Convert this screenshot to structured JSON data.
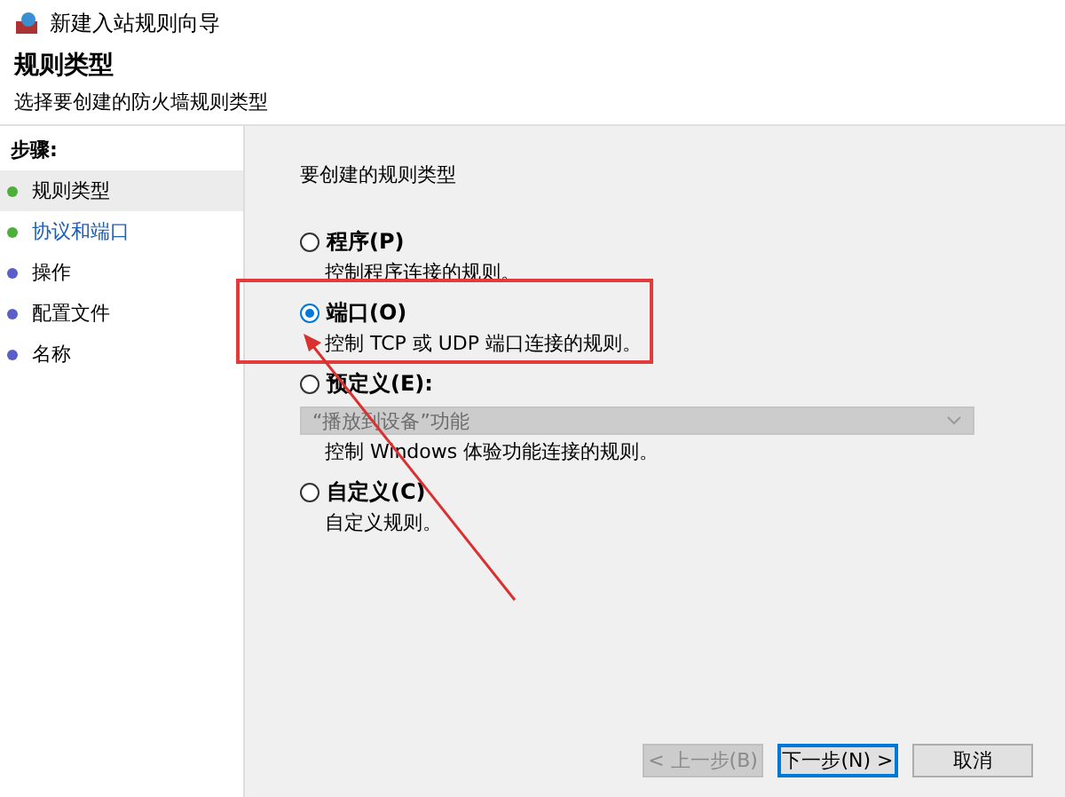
{
  "window": {
    "title": "新建入站规则向导"
  },
  "header": {
    "title": "规则类型",
    "subtitle": "选择要创建的防火墙规则类型"
  },
  "sidebar": {
    "heading": "步骤:",
    "items": [
      {
        "label": "规则类型",
        "selected": true,
        "kind": "plain",
        "color": "#4caf3c"
      },
      {
        "label": "协议和端口",
        "selected": false,
        "kind": "link",
        "color": "#4caf3c"
      },
      {
        "label": "操作",
        "selected": false,
        "kind": "plain",
        "color": "#5a5fc8"
      },
      {
        "label": "配置文件",
        "selected": false,
        "kind": "plain",
        "color": "#5a5fc8"
      },
      {
        "label": "名称",
        "selected": false,
        "kind": "plain",
        "color": "#5a5fc8"
      }
    ]
  },
  "main": {
    "prompt": "要创建的规则类型",
    "options": [
      {
        "label": "程序(P)",
        "description": "控制程序连接的规则。",
        "selected": false
      },
      {
        "label": "端口(O)",
        "description": "控制 TCP 或 UDP 端口连接的规则。",
        "selected": true
      },
      {
        "label": "预定义(E):",
        "dropdown": {
          "value": "“播放到设备”功能",
          "disabled": true
        },
        "description": "控制 Windows 体验功能连接的规则。",
        "selected": false
      },
      {
        "label": "自定义(C)",
        "description": "自定义规则。",
        "selected": false
      }
    ]
  },
  "buttons": [
    {
      "label": "< 上一步(B)",
      "disabled": true,
      "default": false
    },
    {
      "label": "下一步(N) >",
      "disabled": false,
      "default": true
    },
    {
      "label": "取消",
      "disabled": false,
      "default": false
    }
  ]
}
